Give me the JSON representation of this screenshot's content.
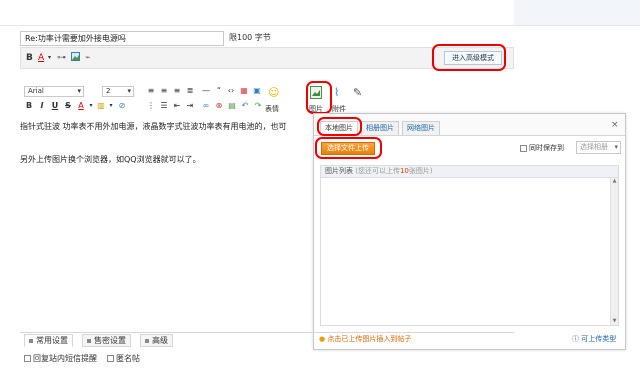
{
  "subject": {
    "value": "Re:功率计需要加外接电源吗",
    "limit": "限100 字节"
  },
  "simple_toolbar": {
    "bold": "B",
    "color": "A",
    "advanced_mode": "进入高级模式"
  },
  "format_toolbar": {
    "font": "Arial",
    "size": "2",
    "row2_bold": "B",
    "row2_italic": "I",
    "row2_underline": "U",
    "row2_strike": "S",
    "row2_color": "A",
    "emoticon_label": "表情",
    "image_label": "图片",
    "attachment_label": "附件"
  },
  "editor": {
    "line1": "指针式驻波 功率表不用外加电源，液晶数字式驻波功率表有用电池的，也可",
    "line2": "另外上传图片换个浏览器，如QQ浏览器就可以了。"
  },
  "image_dialog": {
    "tabs": [
      "本地图片",
      "相册图片",
      "网络图片"
    ],
    "close": "×",
    "upload_button": "选择文件上传",
    "save_to_label": "同时保存到",
    "album_placeholder": "选择相册",
    "list_title": "图片列表",
    "list_note_prefix": "(您还可以上传",
    "list_note_count": "10",
    "list_note_suffix": "张图片)",
    "footer_tip": "点击已上传图片插入到帖子",
    "footer_help": "可上传类型"
  },
  "bottom": {
    "tabs": [
      "常用设置",
      "售密设置",
      "高级"
    ],
    "options": [
      "回复站内短信提醒",
      "匿名帖"
    ]
  },
  "colors": {
    "highlight": "#e00000",
    "upload_button": "#f39a2c",
    "link": "#1a62a8"
  }
}
